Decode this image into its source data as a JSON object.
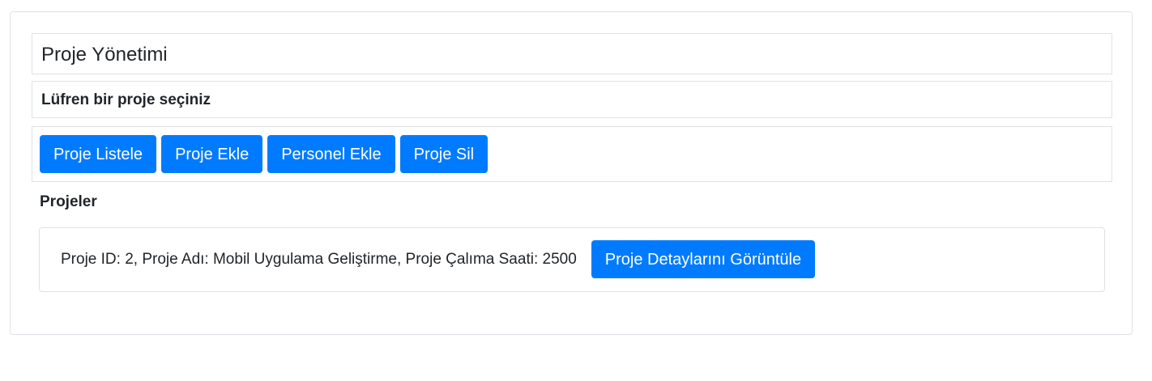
{
  "header": {
    "title": "Proje Yönetimi"
  },
  "prompt": {
    "text": "Lüfren bir proje seçiniz"
  },
  "toolbar": {
    "buttons": [
      {
        "label": "Proje Listele"
      },
      {
        "label": "Proje Ekle"
      },
      {
        "label": "Personel Ekle"
      },
      {
        "label": "Proje Sil"
      }
    ]
  },
  "projects": {
    "heading": "Projeler",
    "items": [
      {
        "text": "Proje ID: 2, Proje Adı: Mobil Uygulama Geliştirme, Proje Çalıma Saati: 2500",
        "button_label": "Proje Detaylarını Görüntüle"
      }
    ]
  },
  "colors": {
    "primary": "#007bff",
    "border": "#dee2e6",
    "text": "#212529"
  }
}
